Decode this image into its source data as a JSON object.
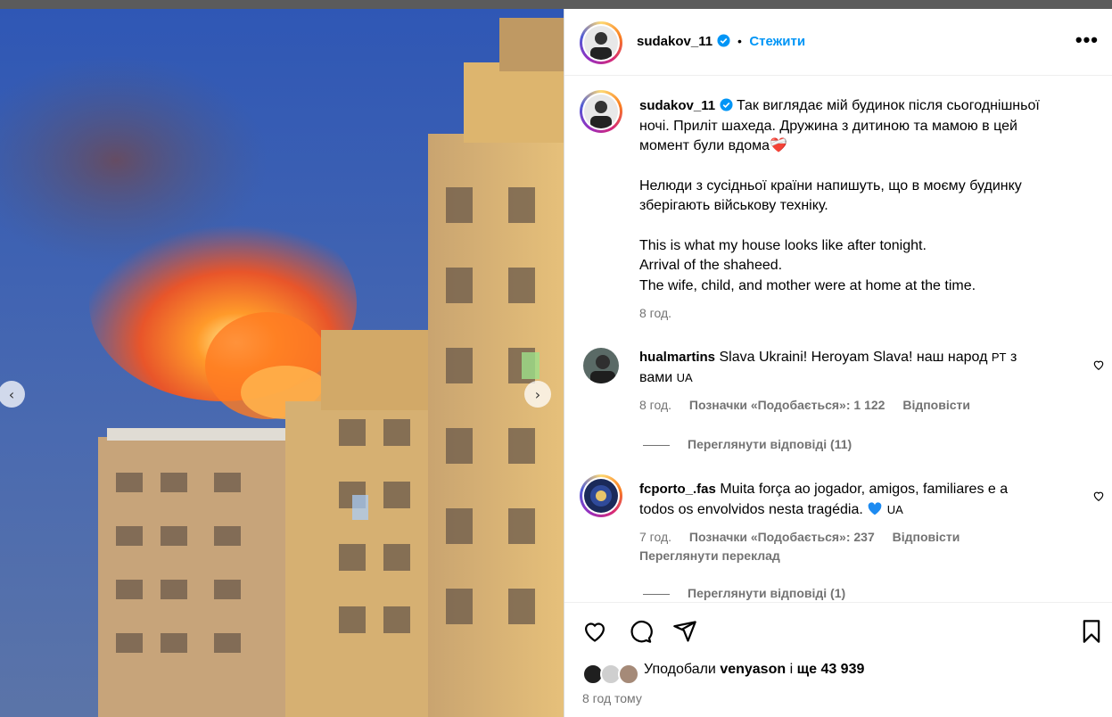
{
  "post": {
    "username": "sudakov_11",
    "follow_label": "Стежити",
    "more_label": "•••",
    "caption_lines": [
      "Так виглядає мій будинок після сьогоднішньої",
      "ночі. Приліт шахеда. Дружина з дитиною та мамою в цей",
      "момент були вдома"
    ],
    "caption_emoji": "❤️‍🩹",
    "caption_p2": [
      "Нелюди з сусідньої країни напишуть, що в моєму будинку",
      "зберігають військову техніку."
    ],
    "caption_p3": [
      "This is what my house looks like after tonight.",
      "Arrival of the shaheed.",
      "The wife, child, and mother were at home at the time."
    ],
    "caption_time": "8 год."
  },
  "comments": [
    {
      "username": "hualmartins",
      "text_line1": "Slava Ukraini! Heroyam Slava! наш народ",
      "flag1": "PT",
      "text_mid": " з",
      "text_line2": "вами",
      "flag2": "UA",
      "time": "8 год.",
      "likes": "Позначки «Подобається»: 1 122",
      "reply": "Відповісти",
      "view_replies": "Переглянути відповіді (11)"
    },
    {
      "username": "fcporto_.fas",
      "text_line1": "Muita força ao jogador, amigos, familiares e a",
      "text_line2": "todos os envolvidos nesta tragédia.",
      "flag": "UA",
      "time": "7 год.",
      "likes": "Позначки «Подобається»: 237",
      "reply": "Відповісти",
      "translate": "Переглянути переклад",
      "view_replies": "Переглянути відповіді (1)"
    }
  ],
  "footer": {
    "liked_by_prefix": "Уподобали",
    "liked_by_user": "venyason",
    "liked_by_mid": "і",
    "liked_by_count": "ще 43 939",
    "date": "8 год тому"
  },
  "colors": {
    "accent": "#0095f6",
    "muted": "#737373",
    "fire": "#ff6a1a"
  },
  "icons": [
    "heart-icon",
    "comment-icon",
    "share-icon",
    "bookmark-icon",
    "verified-icon",
    "more-icon",
    "chevron-left-icon",
    "chevron-right-icon"
  ]
}
